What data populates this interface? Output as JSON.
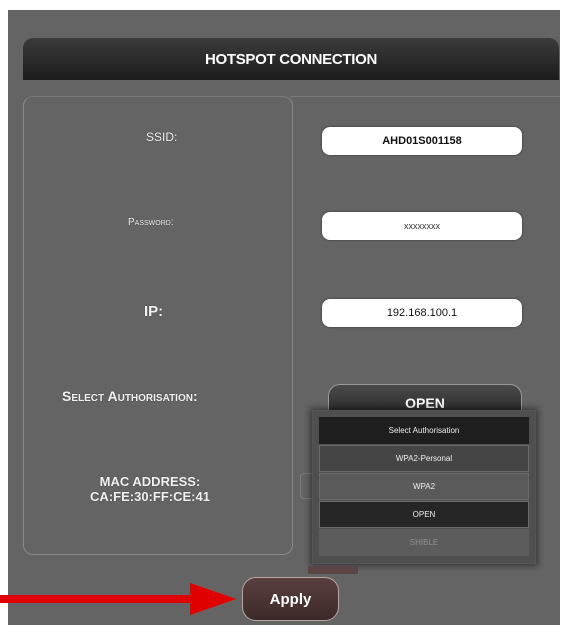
{
  "header": {
    "title": "HOTSPOT CONNECTION"
  },
  "form": {
    "ssid_label": "SSID:",
    "ssid_value": "AHD01S001158",
    "password_label": "Password:",
    "password_value": "xxxxxxxx",
    "ip_label": "IP:",
    "ip_value": "192.168.100.1",
    "auth_label": "Select Authorisation:",
    "auth_selected": "OPEN",
    "mac_label": "MAC ADDRESS:",
    "mac_value": "CA:FE:30:FF:CE:41"
  },
  "dropdown": {
    "header": "Select Authorisation",
    "options": [
      "WPA2-Personal",
      "WPA2",
      "OPEN",
      "SHIBLE"
    ]
  },
  "apply_label": "Apply",
  "colors": {
    "arrow": "#e00000",
    "panel": "#646464",
    "apply": "#4a3434"
  }
}
